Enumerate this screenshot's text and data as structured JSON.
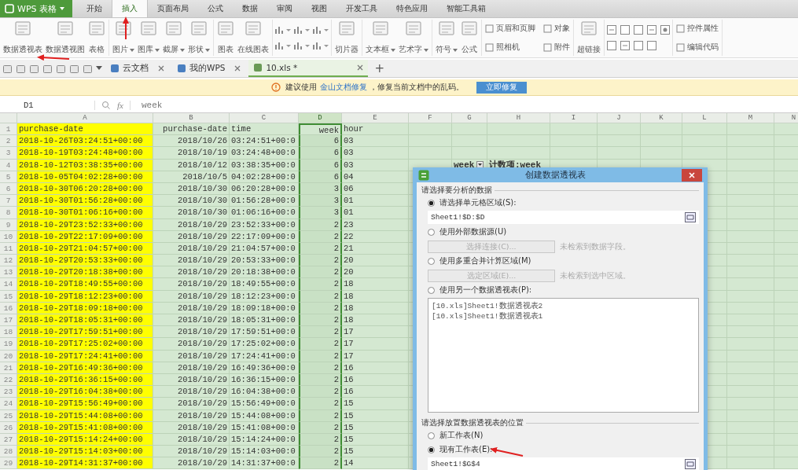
{
  "app_button": {
    "label": "WPS 表格"
  },
  "menu_tabs": [
    {
      "label": "开始",
      "selected": false
    },
    {
      "label": "插入",
      "selected": true
    },
    {
      "label": "页面布局",
      "selected": false
    },
    {
      "label": "公式",
      "selected": false
    },
    {
      "label": "数据",
      "selected": false
    },
    {
      "label": "审阅",
      "selected": false
    },
    {
      "label": "视图",
      "selected": false
    },
    {
      "label": "开发工具",
      "selected": false
    },
    {
      "label": "特色应用",
      "selected": false
    },
    {
      "label": "智能工具箱",
      "selected": false
    }
  ],
  "ribbon": [
    {
      "kind": "large",
      "items": [
        {
          "label": "数据透视表",
          "dropdown": false
        },
        {
          "label": "数据透视图",
          "dropdown": false
        },
        {
          "label": "表格",
          "dropdown": false
        }
      ]
    },
    {
      "kind": "large",
      "items": [
        {
          "label": "图片",
          "dropdown": true
        },
        {
          "label": "图库",
          "dropdown": true
        },
        {
          "label": "截屏",
          "dropdown": true
        },
        {
          "label": "形状",
          "dropdown": true
        }
      ]
    },
    {
      "kind": "large",
      "items": [
        {
          "label": "图表",
          "dropdown": false
        },
        {
          "label": "在线图表",
          "dropdown": false
        }
      ]
    },
    {
      "kind": "chart_icons"
    },
    {
      "kind": "large",
      "items": [
        {
          "label": "切片器",
          "dropdown": false
        }
      ]
    },
    {
      "kind": "large",
      "items": [
        {
          "label": "文本框",
          "dropdown": true
        },
        {
          "label": "艺术字",
          "dropdown": true
        }
      ]
    },
    {
      "kind": "large",
      "items": [
        {
          "label": "符号",
          "dropdown": true
        },
        {
          "label": "公式",
          "dropdown": false
        }
      ]
    },
    {
      "kind": "small",
      "items": [
        {
          "label": "页眉和页脚"
        },
        {
          "label": "照相机"
        },
        {
          "label": "对象"
        },
        {
          "label": "附件"
        }
      ]
    },
    {
      "kind": "large",
      "items": [
        {
          "label": "超链接",
          "dropdown": false
        }
      ]
    },
    {
      "kind": "form_controls"
    },
    {
      "kind": "small",
      "items": [
        {
          "label": "控件属性"
        },
        {
          "label": "编辑代码"
        }
      ]
    }
  ],
  "doc_tabs": [
    {
      "label": "云文档",
      "selected": false
    },
    {
      "label": "我的WPS",
      "selected": false
    },
    {
      "label": "10.xls *",
      "selected": true
    }
  ],
  "new_tab": "+",
  "notice": {
    "before": "建议使用 ",
    "link": "金山文档修复",
    "after": " ，修复当前文档中的乱码。",
    "button": "立即修复"
  },
  "name_box": "D1",
  "fx": "fx",
  "formula": "week",
  "columns": [
    {
      "label": "A",
      "selected": false,
      "color": "#ffff00"
    },
    {
      "label": "B",
      "selected": false
    },
    {
      "label": "C",
      "selected": false
    },
    {
      "label": "D",
      "selected": true
    },
    {
      "label": "E",
      "selected": false
    },
    {
      "label": "F",
      "selected": false
    },
    {
      "label": "G",
      "selected": false
    },
    {
      "label": "H",
      "selected": false
    },
    {
      "label": "I",
      "selected": false
    },
    {
      "label": "J",
      "selected": false
    },
    {
      "label": "K",
      "selected": false
    },
    {
      "label": "L",
      "selected": false
    },
    {
      "label": "M",
      "selected": false
    },
    {
      "label": "N",
      "selected": false
    }
  ],
  "rows": [
    {
      "n": "1",
      "cells": [
        "purchase-date",
        "purchase-date",
        "time",
        "week",
        "hour"
      ]
    },
    {
      "n": "2",
      "cells": [
        "2018-10-26T03:24:51+00:00",
        "2018/10/26",
        "03:24:51+00:0",
        "6",
        "03"
      ]
    },
    {
      "n": "3",
      "cells": [
        "2018-10-19T03:24:48+00:00",
        "2018/10/19",
        "03:24:48+00:0",
        "6",
        "03"
      ]
    },
    {
      "n": "4",
      "cells": [
        "2018-10-12T03:38:35+00:00",
        "2018/10/12",
        "03:38:35+00:0",
        "6",
        "03"
      ],
      "pivot": {
        "row_field": "week",
        "value_field": "计数项:week"
      }
    },
    {
      "n": "5",
      "cells": [
        "2018-10-05T04:02:28+00:00",
        "2018/10/5",
        "04:02:28+00:0",
        "6",
        "04"
      ]
    },
    {
      "n": "6",
      "cells": [
        "2018-10-30T06:20:28+00:00",
        "2018/10/30",
        "06:20:28+00:0",
        "3",
        "06"
      ]
    },
    {
      "n": "7",
      "cells": [
        "2018-10-30T01:56:28+00:00",
        "2018/10/30",
        "01:56:28+00:0",
        "3",
        "01"
      ]
    },
    {
      "n": "8",
      "cells": [
        "2018-10-30T01:06:16+00:00",
        "2018/10/30",
        "01:06:16+00:0",
        "3",
        "01"
      ]
    },
    {
      "n": "9",
      "cells": [
        "2018-10-29T23:52:33+00:00",
        "2018/10/29",
        "23:52:33+00:0",
        "2",
        "23"
      ]
    },
    {
      "n": "10",
      "cells": [
        "2018-10-29T22:17:09+00:00",
        "2018/10/29",
        "22:17:09+00:0",
        "2",
        "22"
      ]
    },
    {
      "n": "11",
      "cells": [
        "2018-10-29T21:04:57+00:00",
        "2018/10/29",
        "21:04:57+00:0",
        "2",
        "21"
      ]
    },
    {
      "n": "12",
      "cells": [
        "2018-10-29T20:53:33+00:00",
        "2018/10/29",
        "20:53:33+00:0",
        "2",
        "20"
      ]
    },
    {
      "n": "13",
      "cells": [
        "2018-10-29T20:18:38+00:00",
        "2018/10/29",
        "20:18:38+00:0",
        "2",
        "20"
      ]
    },
    {
      "n": "14",
      "cells": [
        "2018-10-29T18:49:55+00:00",
        "2018/10/29",
        "18:49:55+00:0",
        "2",
        "18"
      ]
    },
    {
      "n": "15",
      "cells": [
        "2018-10-29T18:12:23+00:00",
        "2018/10/29",
        "18:12:23+00:0",
        "2",
        "18"
      ]
    },
    {
      "n": "16",
      "cells": [
        "2018-10-29T18:09:18+00:00",
        "2018/10/29",
        "18:09:18+00:0",
        "2",
        "18"
      ]
    },
    {
      "n": "17",
      "cells": [
        "2018-10-29T18:05:31+00:00",
        "2018/10/29",
        "18:05:31+00:0",
        "2",
        "18"
      ]
    },
    {
      "n": "18",
      "cells": [
        "2018-10-29T17:59:51+00:00",
        "2018/10/29",
        "17:59:51+00:0",
        "2",
        "17"
      ]
    },
    {
      "n": "19",
      "cells": [
        "2018-10-29T17:25:02+00:00",
        "2018/10/29",
        "17:25:02+00:0",
        "2",
        "17"
      ]
    },
    {
      "n": "20",
      "cells": [
        "2018-10-29T17:24:41+00:00",
        "2018/10/29",
        "17:24:41+00:0",
        "2",
        "17"
      ]
    },
    {
      "n": "21",
      "cells": [
        "2018-10-29T16:49:36+00:00",
        "2018/10/29",
        "16:49:36+00:0",
        "2",
        "16"
      ]
    },
    {
      "n": "22",
      "cells": [
        "2018-10-29T16:36:15+00:00",
        "2018/10/29",
        "16:36:15+00:0",
        "2",
        "16"
      ]
    },
    {
      "n": "23",
      "cells": [
        "2018-10-29T16:04:38+00:00",
        "2018/10/29",
        "16:04:38+00:0",
        "2",
        "16"
      ]
    },
    {
      "n": "24",
      "cells": [
        "2018-10-29T15:56:49+00:00",
        "2018/10/29",
        "15:56:49+00:0",
        "2",
        "15"
      ]
    },
    {
      "n": "25",
      "cells": [
        "2018-10-29T15:44:08+00:00",
        "2018/10/29",
        "15:44:08+00:0",
        "2",
        "15"
      ]
    },
    {
      "n": "26",
      "cells": [
        "2018-10-29T15:41:08+00:00",
        "2018/10/29",
        "15:41:08+00:0",
        "2",
        "15"
      ]
    },
    {
      "n": "27",
      "cells": [
        "2018-10-29T15:14:24+00:00",
        "2018/10/29",
        "15:14:24+00:0",
        "2",
        "15"
      ]
    },
    {
      "n": "28",
      "cells": [
        "2018-10-29T15:14:03+00:00",
        "2018/10/29",
        "15:14:03+00:0",
        "2",
        "15"
      ]
    },
    {
      "n": "29",
      "cells": [
        "2018-10-29T14:31:37+00:00",
        "2018/10/29",
        "14:31:37+00:0",
        "2",
        "14"
      ]
    }
  ],
  "dialog": {
    "title": "创建数据透视表",
    "sections": [
      {
        "title": "请选择要分析的数据",
        "items": [
          {
            "kind": "radio",
            "label": "请选择单元格区域(S):",
            "selected": true
          },
          {
            "kind": "field",
            "value": "Sheet1!$D:$D"
          },
          {
            "kind": "radio",
            "label": "使用外部数据源(U)",
            "selected": false
          },
          {
            "kind": "button_row",
            "button": "选择连接(C)...",
            "note": "未检索到数据字段。"
          },
          {
            "kind": "radio",
            "label": "使用多重合并计算区域(M)",
            "selected": false
          },
          {
            "kind": "button_row",
            "button": "选定区域(E)...",
            "note": "未检索到选中区域。"
          },
          {
            "kind": "radio",
            "label": "使用另一个数据透视表(P):",
            "selected": false
          },
          {
            "kind": "list",
            "entries": [
              "[10.xls]Sheet1!数据透视表2",
              "[10.xls]Sheet1!数据透视表1"
            ]
          }
        ]
      },
      {
        "title": "请选择放置数据透视表的位置",
        "items": [
          {
            "kind": "radio",
            "label": "新工作表(N)",
            "selected": false
          },
          {
            "kind": "radio",
            "label": "现有工作表(E):",
            "selected": true
          },
          {
            "kind": "field",
            "value": "Sheet1!$G$4"
          }
        ]
      }
    ]
  }
}
